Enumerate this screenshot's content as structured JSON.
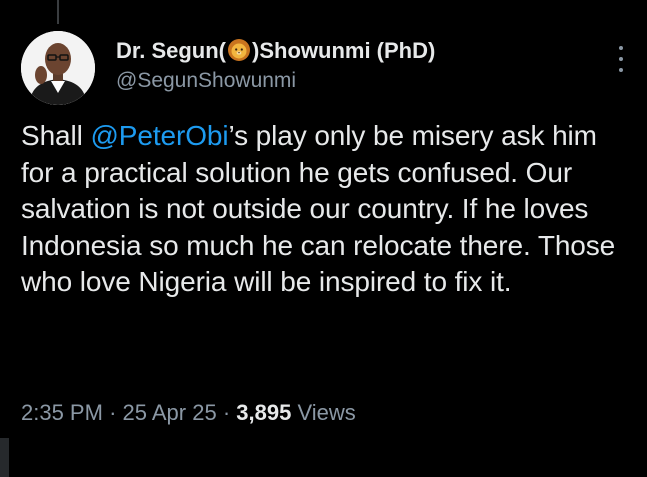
{
  "tweet": {
    "author": {
      "display_name_prefix": "Dr. Segun(",
      "display_name_emoji": "lion-emoji",
      "display_name_suffix": ")Showunmi (PhD)",
      "handle": "@SegunShowunmi",
      "avatar": "avatar"
    },
    "text": {
      "part1": "Shall ",
      "mention": "@PeterObi",
      "part2": "’s play only be misery ask him for a practical solution he gets confused. Our salvation is not outside our country. If he loves Indonesia so much he can relocate there. Those who love Nigeria will be inspired to fix it."
    },
    "meta": {
      "time": "2:35 PM",
      "separator": "·",
      "date": "25 Apr 25",
      "views_count": "3,895",
      "views_label": "Views"
    },
    "more_icon": "more-vertical-icon"
  },
  "colors": {
    "background": "#000000",
    "text": "#e7e9ea",
    "secondary": "#8b98a5",
    "mention": "#1d9bf0"
  }
}
